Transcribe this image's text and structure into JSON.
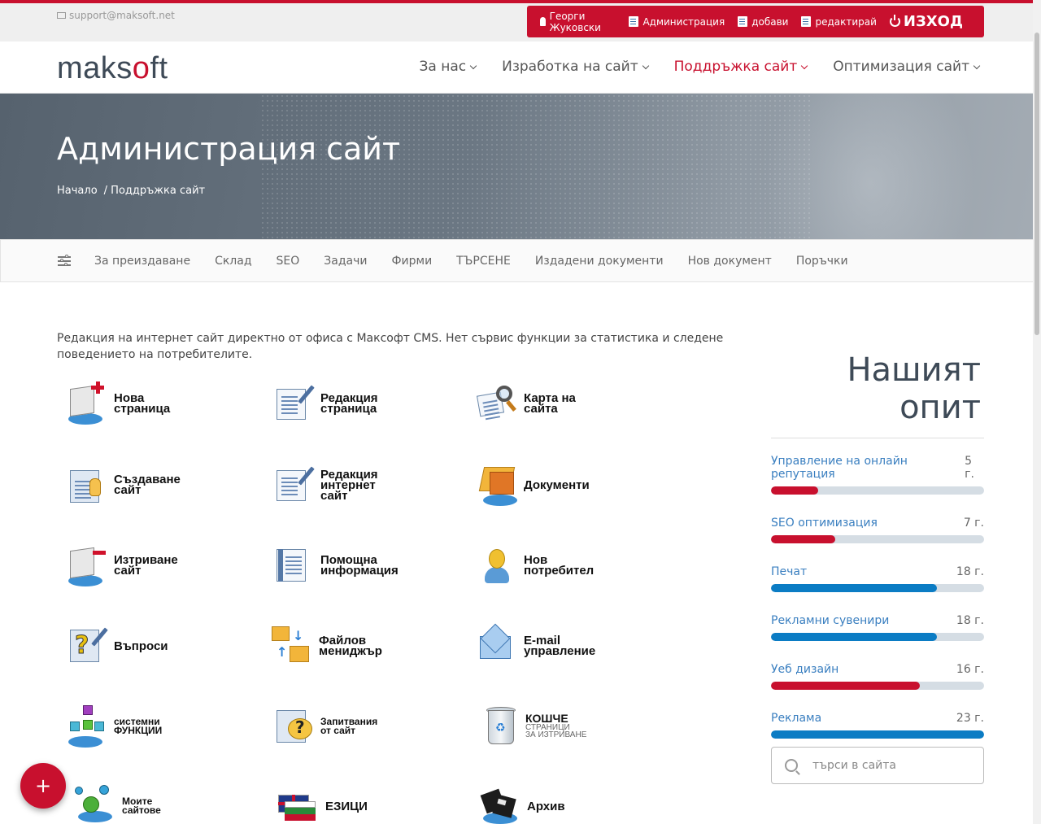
{
  "topbar": {
    "email": "support@maksoft.net",
    "user": "Георги Жуковски",
    "admin": "Администрация",
    "add": "добави",
    "edit": "редактирай",
    "logout": "ИЗХОД"
  },
  "logo": {
    "pre": "maks",
    "o": "o",
    "post": "ft"
  },
  "nav": [
    {
      "label": "За нас"
    },
    {
      "label": "Изработка на сайт"
    },
    {
      "label": "Поддръжка сайт"
    },
    {
      "label": "Оптимизация сайт"
    }
  ],
  "hero": {
    "title": "Администрация сайт",
    "crumb_home": "Начало",
    "crumb_current": "/ Поддръжка сайт"
  },
  "subnav": [
    "За преиздаване",
    "Склад",
    "SEO",
    "Задачи",
    "Фирми",
    "ТЪРСЕНЕ",
    "Издадени документи",
    "Нов документ",
    "Поръчки"
  ],
  "intro": "Редакция на интернет сайт директно от офиса с Максофт CMS. Нет сървис функции за статистика и следене поведението на потребителите.",
  "tiles": [
    {
      "label": "Нова\nстраница",
      "icon": "new-page-icon"
    },
    {
      "label": "Редакция\nстраница",
      "icon": "edit-page-icon"
    },
    {
      "label": "Карта на\nсайта",
      "icon": "sitemap-icon"
    },
    {
      "label": "Създаване\nсайт",
      "icon": "create-site-icon"
    },
    {
      "label": "Редакция\nинтернет\nсайт",
      "icon": "edit-site-icon"
    },
    {
      "label": "Документи",
      "icon": "documents-icon"
    },
    {
      "label": "Изтриване\nсайт",
      "icon": "delete-site-icon"
    },
    {
      "label": "Помощна\nинформация",
      "icon": "help-info-icon"
    },
    {
      "label": "Нов\nпотребител",
      "icon": "new-user-icon"
    },
    {
      "label": "Въпроси",
      "icon": "questions-icon"
    },
    {
      "label": "Файлов\nмениджър",
      "icon": "file-manager-icon"
    },
    {
      "label": "E-mail\nуправление",
      "icon": "email-icon"
    },
    {
      "label": "системни\nФУНКЦИИ",
      "icon": "system-functions-icon"
    },
    {
      "label": "Запитвания\nот сайт",
      "icon": "inquiries-icon"
    },
    {
      "label": "КОШЧЕ",
      "sub": "СТРАНИЦИ\nЗА ИЗТРИВАНЕ",
      "icon": "trash-icon"
    },
    {
      "label": "Моите\nсайтове",
      "icon": "my-sites-icon"
    },
    {
      "label": "ЕЗИЦИ",
      "icon": "languages-icon"
    },
    {
      "label": "Архив",
      "icon": "archive-icon"
    }
  ],
  "sidebar": {
    "title": "Нашият опит",
    "skills": [
      {
        "name": "Управление на онлайн репутация",
        "years": "5 г.",
        "fill": 0.22,
        "color": "#c8102e"
      },
      {
        "name": "SEO оптимизация",
        "years": "7 г.",
        "fill": 0.3,
        "color": "#c8102e"
      },
      {
        "name": "Печат",
        "years": "18 г.",
        "fill": 0.78,
        "color": "#0b7cc4"
      },
      {
        "name": "Рекламни сувенири",
        "years": "18 г.",
        "fill": 0.78,
        "color": "#0b7cc4"
      },
      {
        "name": "Уеб дизайн",
        "years": "16 г.",
        "fill": 0.7,
        "color": "#c8102e"
      },
      {
        "name": "Реклама",
        "years": "23 г.",
        "fill": 1.0,
        "color": "#0b7cc4"
      }
    ]
  },
  "search": {
    "placeholder": "търси в сайта"
  },
  "fab": "+",
  "colors": {
    "accent": "#c8102e",
    "blue": "#0b7cc4"
  }
}
